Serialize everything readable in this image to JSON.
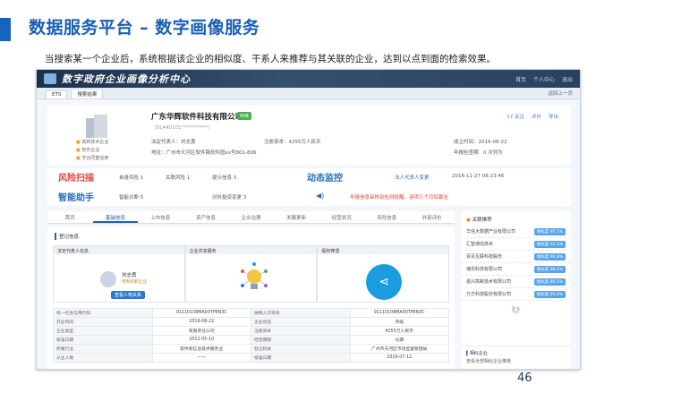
{
  "slide": {
    "title": "数据服务平台 – 数字画像服务",
    "subtitle": "当搜索某一个企业后，系统根据该企业的相似度、干系人来推荐与其关联的企业，达到以点到面的检索效果。",
    "page_number": "46"
  },
  "app": {
    "title": "数字政府企业画像分析中心",
    "header_links": [
      "首页",
      "个人中心",
      "退出"
    ],
    "tabs": [
      "ETS",
      "搜索结果"
    ],
    "tab_right": "返回上一页"
  },
  "company": {
    "name": "广东华辉软件科技有限公司",
    "badge": "存续",
    "credit_code": "（91440101***********）",
    "tags": [
      "高新技术企业",
      "软件企业",
      "守合同重信用"
    ],
    "legal_rep": "法定代表人：刘志勇",
    "reg_capital": "注册资本：4255万人民币",
    "est_date": "成立时间：2016-08-22",
    "address": "地址：广州市天河区软件路软件园xx号801-806",
    "actions": [
      "17 关注",
      "评价",
      "导出"
    ],
    "update": "年报检查期：0 次列为"
  },
  "risk": {
    "scan_title": "风险扫描",
    "scan_items": [
      "自身风险 1",
      "关联风险 1",
      "提示信息 3"
    ],
    "monitor_title": "动态监控",
    "monitor_item": "法人代表人变更",
    "monitor_time": "2016-11-27 08:23:46",
    "assist_title": "智能助手",
    "assist_items": [
      "智能诊断 5",
      "对外投资变更 3"
    ],
    "assist_alert": "年报信息审核及检测提醒，该项三个月后截至"
  },
  "nav_tabs": [
    "首页",
    "基础信息",
    "上市信息",
    "资产信息",
    "企业治理",
    "发展更新",
    "经营状况",
    "风险信息",
    "外部评价"
  ],
  "main": {
    "section": "登记信息",
    "cards": [
      "法定代表人信息",
      "企业共享服务",
      "股权穿透"
    ],
    "person_name": "刘志勇",
    "person_company": "他有8家企业",
    "person_button": "查看人物关系",
    "table": [
      [
        "统一社会信用代码",
        "91110108MA00TPEN3C",
        "纳税人识别号",
        "91110108MA00TPEN3C"
      ],
      [
        "开业时间",
        "2016-08-22",
        "企业状态",
        "存续"
      ],
      [
        "企业类型",
        "有限责任公司",
        "注册资本",
        "4255万人民币"
      ],
      [
        "核准日期",
        "2012-05-10",
        "经营期限",
        "长期"
      ],
      [
        "所属行业",
        "软件和信息技术服务业",
        "登记机关",
        "广州市天河区市场监督管理局"
      ],
      [
        "从业人数",
        "——",
        "核准日期",
        "2016-07-12"
      ]
    ]
  },
  "side": {
    "title": "关联推荐",
    "items": [
      {
        "name": "华信大数据产业有限公司",
        "score": "相似度 95.1%"
      },
      {
        "name": "汇智通信技术",
        "score": "相似度 92.4%"
      },
      {
        "name": "百见互联科技股份",
        "score": "相似度 90.8%"
      },
      {
        "name": "瑞讯科技有限公司",
        "score": "相似度 88.2%"
      },
      {
        "name": "嘉兴高新技术有限公司",
        "score": "相似度 86.5%"
      },
      {
        "name": "万方科技股份有限公司",
        "score": "相似度 85.0%"
      }
    ],
    "more": "更多",
    "box_title": "相似企业",
    "box_line": "查看全部相似企业推荐"
  }
}
